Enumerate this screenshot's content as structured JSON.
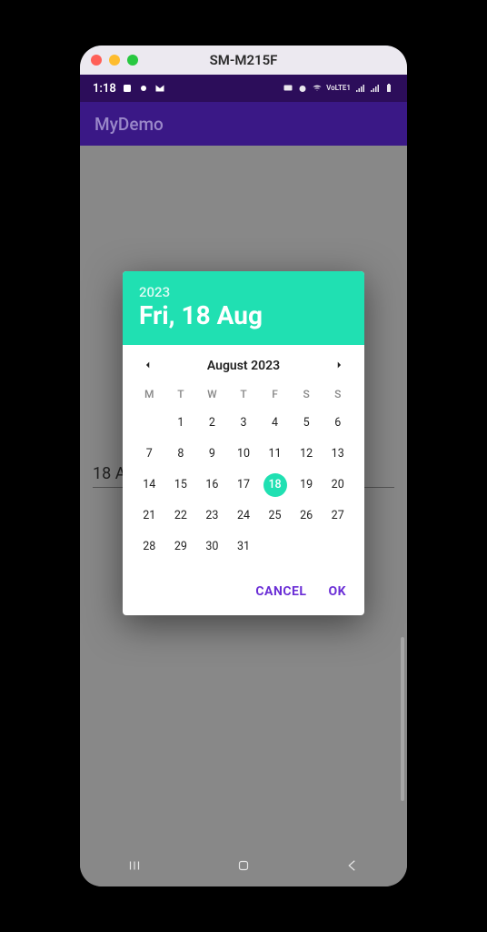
{
  "window": {
    "title": "SM-M215F"
  },
  "status": {
    "time": "1:18",
    "network_label": "VoLTE1"
  },
  "app": {
    "title": "MyDemo"
  },
  "field": {
    "visible_text": "18 A"
  },
  "picker": {
    "year": "2023",
    "date_title": "Fri, 18 Aug",
    "month_label": "August 2023",
    "dow": [
      "M",
      "T",
      "W",
      "T",
      "F",
      "S",
      "S"
    ],
    "leading_blanks": 1,
    "days": 31,
    "selected": 18,
    "cancel": "CANCEL",
    "ok": "OK"
  }
}
